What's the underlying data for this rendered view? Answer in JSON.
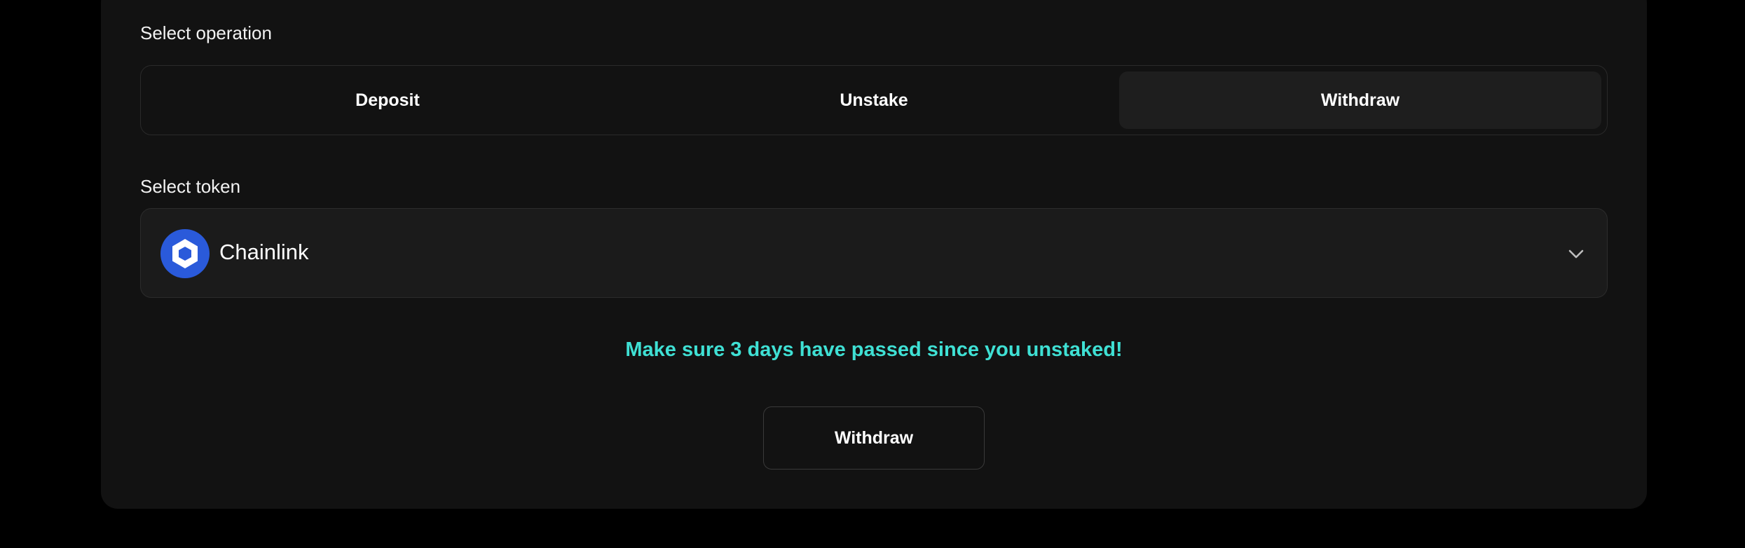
{
  "operation": {
    "label": "Select operation",
    "options": [
      "Deposit",
      "Unstake",
      "Withdraw"
    ],
    "selected": "Withdraw"
  },
  "token": {
    "label": "Select token",
    "selected_name": "Chainlink",
    "icon": "chainlink-logo-icon",
    "dropdown_icon": "chevron-down-icon"
  },
  "warning": {
    "text": "Make sure 3 days have passed since you unstaked!"
  },
  "actions": {
    "withdraw_label": "Withdraw"
  },
  "colors": {
    "background": "#000000",
    "panel": "#121212",
    "segment_selected": "#1e1e1e",
    "select_bg": "#1b1b1b",
    "accent_warning": "#3fe0d4",
    "chainlink_blue": "#2a5ada"
  }
}
